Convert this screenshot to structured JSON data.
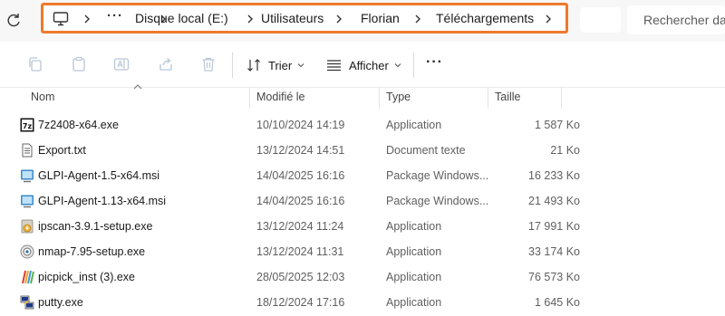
{
  "address": {
    "breadcrumbs": [
      "Disque local (E:)",
      "Utilisateurs",
      "Florian",
      "Téléchargements"
    ],
    "overflow_label": "···",
    "highlight_color": "#ee7a2d"
  },
  "search": {
    "placeholder": "Rechercher dar"
  },
  "toolbar": {
    "sort_label": "Trier",
    "view_label": "Afficher",
    "more_label": "···"
  },
  "columns": {
    "name": "Nom",
    "modified": "Modifié le",
    "type": "Type",
    "size": "Taille"
  },
  "files": [
    {
      "name": "7z2408-x64.exe",
      "modified": "10/10/2024 14:19",
      "type": "Application",
      "size": "1 587 Ko",
      "icon": "7zip-icon"
    },
    {
      "name": "Export.txt",
      "modified": "13/12/2024 14:51",
      "type": "Document texte",
      "size": "21 Ko",
      "icon": "text-file-icon"
    },
    {
      "name": "GLPI-Agent-1.5-x64.msi",
      "modified": "14/04/2025 16:16",
      "type": "Package Windows...",
      "size": "16 233 Ko",
      "icon": "msi-package-icon"
    },
    {
      "name": "GLPI-Agent-1.13-x64.msi",
      "modified": "14/04/2025 16:16",
      "type": "Package Windows...",
      "size": "21 493 Ko",
      "icon": "msi-package-icon"
    },
    {
      "name": "ipscan-3.9.1-setup.exe",
      "modified": "13/12/2024 11:24",
      "type": "Application",
      "size": "17 991 Ko",
      "icon": "installer-icon"
    },
    {
      "name": "nmap-7.95-setup.exe",
      "modified": "13/12/2024 11:31",
      "type": "Application",
      "size": "33 174 Ko",
      "icon": "nmap-icon"
    },
    {
      "name": "picpick_inst (3).exe",
      "modified": "28/05/2025 12:03",
      "type": "Application",
      "size": "76 573 Ko",
      "icon": "picpick-icon"
    },
    {
      "name": "putty.exe",
      "modified": "18/12/2024 17:16",
      "type": "Application",
      "size": "1 645 Ko",
      "icon": "putty-icon"
    }
  ]
}
